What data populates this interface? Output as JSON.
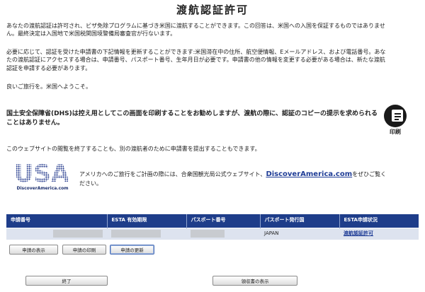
{
  "page": {
    "title": "渡航認証許可"
  },
  "paragraphs": {
    "p1": "あなたの渡航認証は許可され、ビザ免除プログラムに基づき米国に渡航することができます。この回答は、米国への入国を保証するものではありません。最終決定は入国地で米国税関国境警備局審査官が行ないます。",
    "p2": "必要に応じて、認証を受けた申請書の下記情報を更新することができます:米国滞在中の住所、航空便情報、Eメールアドレス、および電話番号。あなたの渡航認証にアクセスする場合は、申請番号、パスポート番号、生年月日が必要です。申請書の他の情報を変更する必要がある場合は、新たな渡航認証を申請する必要があります。",
    "p3": "良いご旅行を。米国へようこそ。",
    "p4": "国土安全保障省(DHS)は控え用としてこの画面を印刷することをお勧めしますが、渡航の際に、認証のコピーの提示を求められることはありません。",
    "p5": "このウェブサイトの閲覧を終了することも、別の渡航者のために申請書を提出することもできます。"
  },
  "print": {
    "label": "印刷",
    "icon": "print-icon"
  },
  "discover": {
    "logo_letters": "USA",
    "logo_text": "DiscoverAmerica.com",
    "text_before": "アメリカへのご旅行をご計画の際には、合衆国観光局公式ウェブサイト、",
    "link_text": "DiscoverAmerica.com",
    "text_after": "をぜひご覧ください。"
  },
  "table": {
    "headers": [
      "申請番号",
      "ESTA 有効期限",
      "パスポート番号",
      "パスポート発行国",
      "ESTA申請状況"
    ],
    "row": {
      "country": "JAPAN",
      "status": "渡航認証許可"
    },
    "colors": {
      "header_bg": "#1e3d8a",
      "row_bg": "#dde3ef"
    }
  },
  "row_buttons": {
    "view": "申請の表示",
    "print": "申請の印刷",
    "update": "申請の更新"
  },
  "footer_buttons": {
    "exit": "終了",
    "receipt": "領収書の表示"
  }
}
